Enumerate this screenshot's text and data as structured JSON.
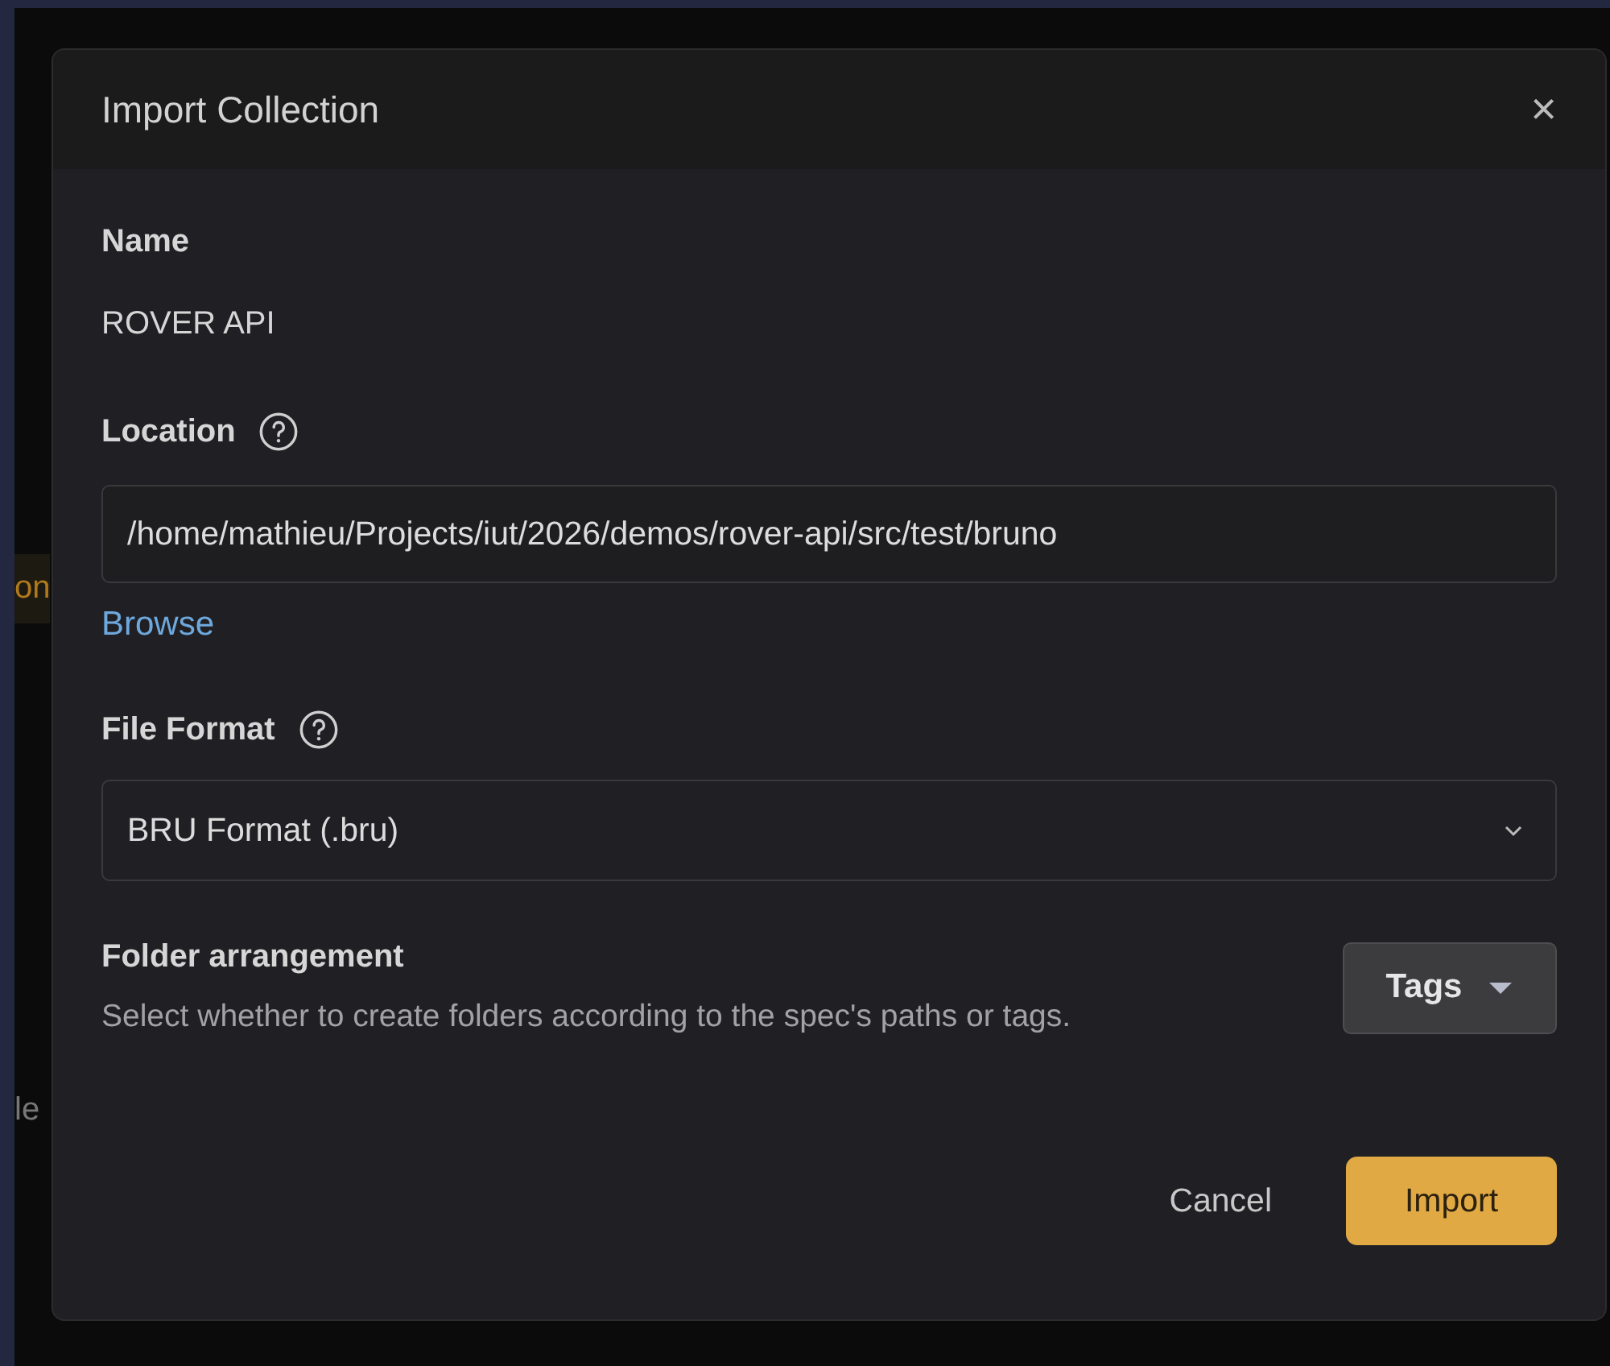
{
  "background": {
    "fragments": [
      {
        "text": "on",
        "kind": "warning"
      },
      {
        "text": "le",
        "kind": "plain"
      }
    ]
  },
  "dialog": {
    "title": "Import Collection",
    "close": "×",
    "name": {
      "label": "Name",
      "value": "ROVER API"
    },
    "location": {
      "label": "Location",
      "value": "/home/mathieu/Projects/iut/2026/demos/rover-api/src/test/bruno",
      "link": "Browse"
    },
    "file_format": {
      "label": "File Format",
      "value": "BRU Format (.bru)"
    },
    "folder_arrangement": {
      "label": "Folder arrangement",
      "description": "Select whether to create folders according to the spec's paths or tags.",
      "value": "Tags"
    },
    "buttons": [
      {
        "label": "Cancel",
        "kind": "secondary"
      },
      {
        "label": "Import",
        "kind": "primary"
      }
    ]
  }
}
